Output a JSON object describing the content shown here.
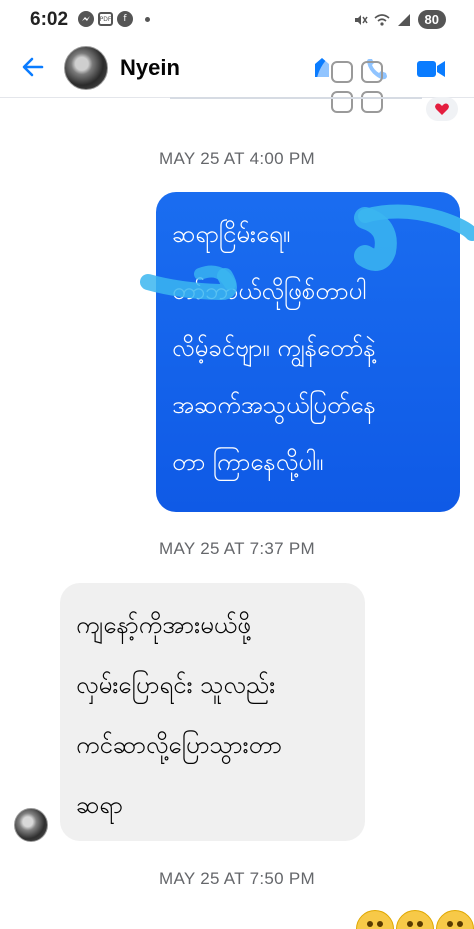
{
  "status_bar": {
    "time": "6:02",
    "battery": "80"
  },
  "header": {
    "contact_name": "Nyein"
  },
  "messages": {
    "timestamp_1": "MAY 25 AT 4:00 PM",
    "sent_lines": [
      "ဆရာငြိမ်းရေ။",
      "တာ်ဘာယ်လိုဖြစ်တာပါ",
      "လိမ့်ခင်ဗျာ။ ကျွန်တော်နဲ့",
      "အဆက်အသွယ်ပြတ်နေ",
      "တာ ကြာနေလို့ပါ။"
    ],
    "timestamp_2": "MAY 25 AT 7:37 PM",
    "received_lines": [
      "ကျနော့်ကိုအားမယ်ဖို့",
      "လှမ်းပြောရင်း သူလည်း",
      "ကင်ဆာလို့ပြောသွားတာ",
      "ဆရာ"
    ],
    "timestamp_3": "MAY 25 AT 7:50 PM"
  },
  "icons": {
    "back": "back-arrow-icon",
    "call": "phone-icon",
    "video": "video-camera-icon",
    "reaction": "heart-icon",
    "overlay": "app-grid-icon"
  },
  "colors": {
    "accent": "#0a7cff",
    "sent_bubble": "#1565f0",
    "received_bubble": "#f0f0f0",
    "timestamp": "#65676b"
  }
}
